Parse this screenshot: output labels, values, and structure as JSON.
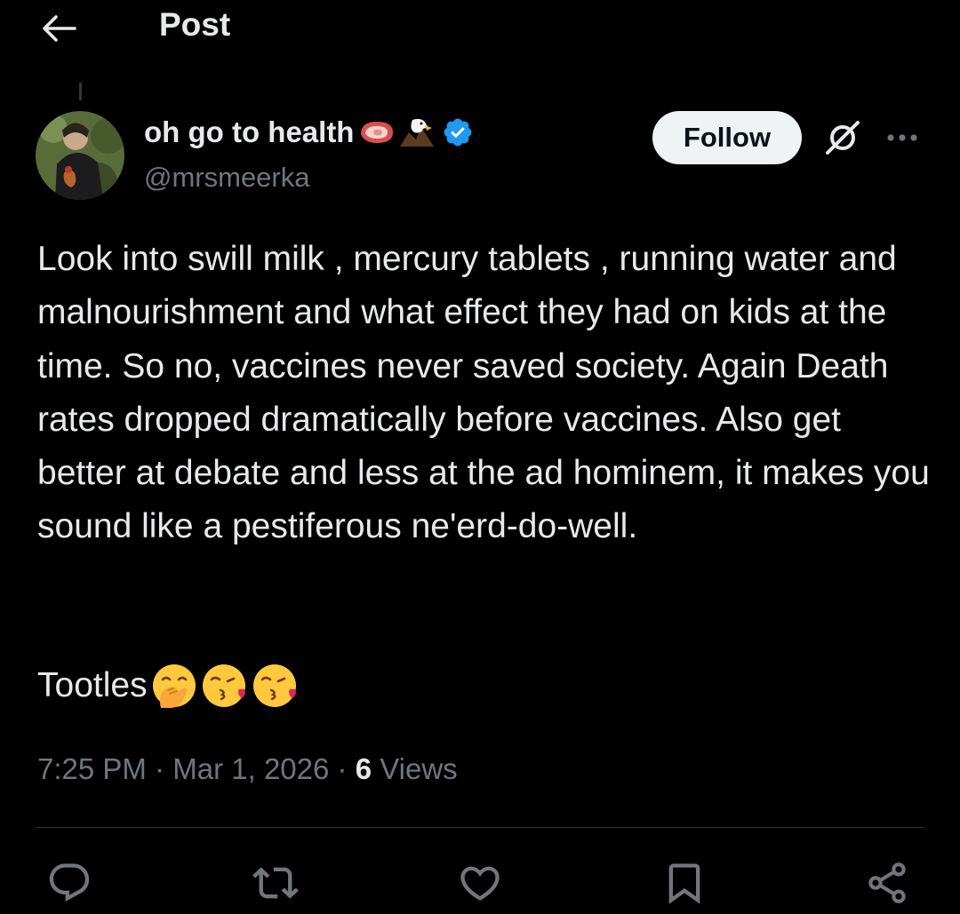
{
  "header": {
    "title": "Post",
    "back_icon": "arrow-left-icon"
  },
  "author": {
    "display_name": "oh go to health",
    "name_emojis": [
      "meat-emoji",
      "eagle-emoji"
    ],
    "verified_icon": "verified-badge-icon",
    "handle": "@mrsmeerka"
  },
  "actions_top": {
    "follow_label": "Follow",
    "grok_icon": "grok-icon",
    "more_icon": "more-dots-icon"
  },
  "post": {
    "text": "Look into swill milk , mercury tablets , running water and malnourishment and what effect they had on kids at the time. So no, vaccines never saved society. Again Death rates dropped dramatically before vaccines. Also get better at debate and less at the ad hominem, it makes you sound like a pestiferous ne'erd-do-well.",
    "closing": "Tootles",
    "closing_emojis": [
      "hand-over-mouth-emoji",
      "face-blowing-kiss-emoji",
      "face-blowing-kiss-emoji"
    ]
  },
  "meta": {
    "time": "7:25 PM",
    "separator": "·",
    "date": "Mar 1, 2026",
    "views_count": "6",
    "views_label": "Views"
  },
  "action_bar": {
    "icons": [
      "reply-icon",
      "repost-icon",
      "like-icon",
      "bookmark-icon",
      "share-icon"
    ]
  },
  "colors": {
    "background": "#000000",
    "text_primary": "#e7e9ea",
    "text_secondary": "#71767b",
    "verified_blue": "#1d9bf0",
    "follow_button_bg": "#eff3f4",
    "divider": "#2f3336"
  }
}
